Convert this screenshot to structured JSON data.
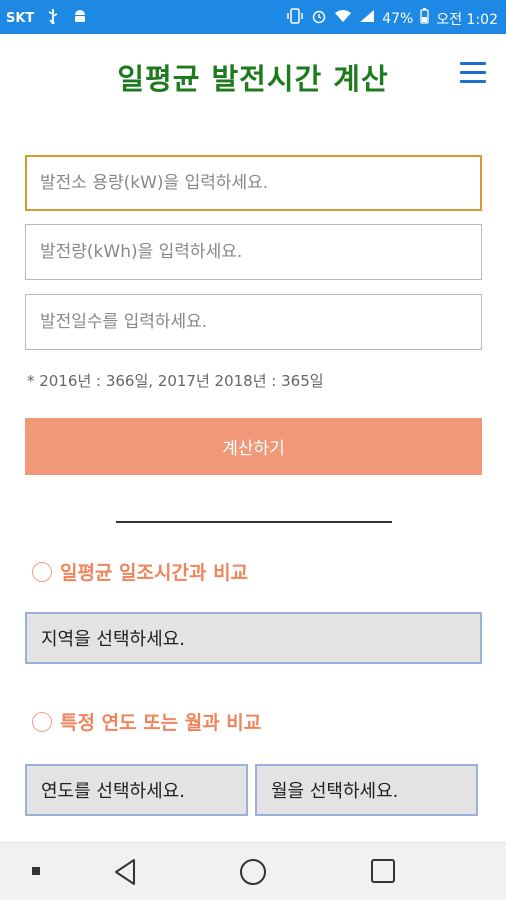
{
  "status_bar": {
    "carrier": "SKT",
    "usb_icon": "usb-icon",
    "android_icon": "android-icon",
    "battery_percent": "47%",
    "time": "오전 1:02"
  },
  "header": {
    "title": "일평균 발전시간 계산"
  },
  "form": {
    "capacity_placeholder": "발전소 용량(kW)을 입력하세요.",
    "generation_placeholder": "발전량(kWh)을 입력하세요.",
    "days_placeholder": "발전일수를 입력하세요.",
    "note": "* 2016년 : 366일, 2017년 2018년 : 365일",
    "calc_label": "계산하기"
  },
  "compare": {
    "section1_label": "일평균 일조시간과 비교",
    "region_select": "지역을 선택하세요.",
    "section2_label": "특정 연도 또는 월과 비교",
    "year_select": "연도를 선택하세요.",
    "month_select": "월을 선택하세요."
  },
  "colors": {
    "status_bar": "#1e88e5",
    "title": "#1d7a1d",
    "accent": "#f09878",
    "section_text": "#f0845c",
    "focus_border": "#d89a2c"
  }
}
